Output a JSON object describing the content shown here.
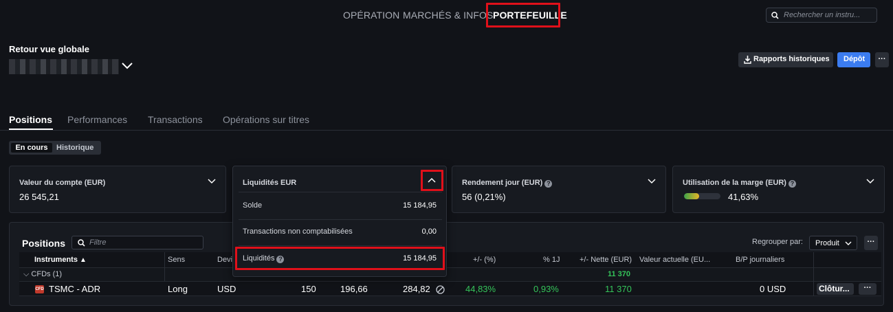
{
  "nav": {
    "items": [
      {
        "label": "OPÉRATION"
      },
      {
        "label": "MARCHÉS & INFOS"
      },
      {
        "label": "PORTEFEUILLE"
      }
    ],
    "search_placeholder": "Rechercher un instru..."
  },
  "header": {
    "back_label": "Retour vue globale",
    "reports_label": "Rapports historiques",
    "deposit_label": "Dépôt",
    "more_label": "···"
  },
  "tabs": [
    {
      "label": "Positions"
    },
    {
      "label": "Performances"
    },
    {
      "label": "Transactions"
    },
    {
      "label": "Opérations sur titres"
    }
  ],
  "toggle": {
    "on": "En cours",
    "off": "Historique"
  },
  "cards": {
    "account": {
      "label": "Valeur du compte (EUR)",
      "value": "26 545,21"
    },
    "daily": {
      "label": "Rendement jour (EUR)",
      "value": "56 (0,21%)"
    },
    "margin": {
      "label": "Utilisation de la marge (EUR)",
      "value": "41,63%",
      "fill_percent": 41.63
    }
  },
  "liquidity_dropdown": {
    "title": "Liquidités EUR",
    "rows": [
      {
        "label": "Solde",
        "value": "15 184,95"
      },
      {
        "label": "Transactions non comptabilisées",
        "value": "0,00"
      },
      {
        "label": "Liquidités",
        "value": "15 184,95"
      }
    ]
  },
  "positions": {
    "title": "Positions",
    "filter_placeholder": "Filtre",
    "group_label": "Regrouper par:",
    "group_value": "Produit",
    "columns": {
      "instruments": "Instruments",
      "sens": "Sens",
      "devise": "Devi",
      "pct": "+/- (%)",
      "pct_1j": "% 1J",
      "nette": "+/- Nette (EUR)",
      "valeur": "Valeur actuelle (EU...",
      "bp": "B/P journaliers"
    },
    "group_row": {
      "label": "CFDs (1)",
      "nette": "11 370"
    },
    "rows": [
      {
        "badge": "CFD",
        "instrument": "TSMC - ADR",
        "sens": "Long",
        "devise": "USD",
        "qty": "150",
        "open_price": "196,66",
        "current_price": "284,82",
        "pct": "44,83%",
        "pct_1j": "0,93%",
        "nette": "11 370",
        "bp": "0 USD",
        "close_label": "Clôtur..."
      }
    ]
  }
}
